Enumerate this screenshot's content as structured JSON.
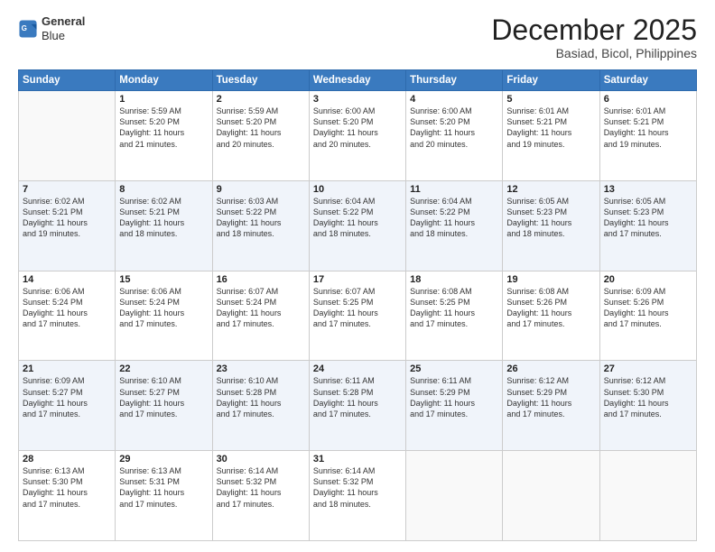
{
  "logo": {
    "line1": "General",
    "line2": "Blue"
  },
  "header": {
    "month": "December 2025",
    "location": "Basiad, Bicol, Philippines"
  },
  "weekdays": [
    "Sunday",
    "Monday",
    "Tuesday",
    "Wednesday",
    "Thursday",
    "Friday",
    "Saturday"
  ],
  "weeks": [
    [
      {
        "day": "",
        "sunrise": "",
        "sunset": "",
        "daylight": ""
      },
      {
        "day": "1",
        "sunrise": "Sunrise: 5:59 AM",
        "sunset": "Sunset: 5:20 PM",
        "daylight": "Daylight: 11 hours and 21 minutes."
      },
      {
        "day": "2",
        "sunrise": "Sunrise: 5:59 AM",
        "sunset": "Sunset: 5:20 PM",
        "daylight": "Daylight: 11 hours and 20 minutes."
      },
      {
        "day": "3",
        "sunrise": "Sunrise: 6:00 AM",
        "sunset": "Sunset: 5:20 PM",
        "daylight": "Daylight: 11 hours and 20 minutes."
      },
      {
        "day": "4",
        "sunrise": "Sunrise: 6:00 AM",
        "sunset": "Sunset: 5:20 PM",
        "daylight": "Daylight: 11 hours and 20 minutes."
      },
      {
        "day": "5",
        "sunrise": "Sunrise: 6:01 AM",
        "sunset": "Sunset: 5:21 PM",
        "daylight": "Daylight: 11 hours and 19 minutes."
      },
      {
        "day": "6",
        "sunrise": "Sunrise: 6:01 AM",
        "sunset": "Sunset: 5:21 PM",
        "daylight": "Daylight: 11 hours and 19 minutes."
      }
    ],
    [
      {
        "day": "7",
        "sunrise": "Sunrise: 6:02 AM",
        "sunset": "Sunset: 5:21 PM",
        "daylight": "Daylight: 11 hours and 19 minutes."
      },
      {
        "day": "8",
        "sunrise": "Sunrise: 6:02 AM",
        "sunset": "Sunset: 5:21 PM",
        "daylight": "Daylight: 11 hours and 18 minutes."
      },
      {
        "day": "9",
        "sunrise": "Sunrise: 6:03 AM",
        "sunset": "Sunset: 5:22 PM",
        "daylight": "Daylight: 11 hours and 18 minutes."
      },
      {
        "day": "10",
        "sunrise": "Sunrise: 6:04 AM",
        "sunset": "Sunset: 5:22 PM",
        "daylight": "Daylight: 11 hours and 18 minutes."
      },
      {
        "day": "11",
        "sunrise": "Sunrise: 6:04 AM",
        "sunset": "Sunset: 5:22 PM",
        "daylight": "Daylight: 11 hours and 18 minutes."
      },
      {
        "day": "12",
        "sunrise": "Sunrise: 6:05 AM",
        "sunset": "Sunset: 5:23 PM",
        "daylight": "Daylight: 11 hours and 18 minutes."
      },
      {
        "day": "13",
        "sunrise": "Sunrise: 6:05 AM",
        "sunset": "Sunset: 5:23 PM",
        "daylight": "Daylight: 11 hours and 17 minutes."
      }
    ],
    [
      {
        "day": "14",
        "sunrise": "Sunrise: 6:06 AM",
        "sunset": "Sunset: 5:24 PM",
        "daylight": "Daylight: 11 hours and 17 minutes."
      },
      {
        "day": "15",
        "sunrise": "Sunrise: 6:06 AM",
        "sunset": "Sunset: 5:24 PM",
        "daylight": "Daylight: 11 hours and 17 minutes."
      },
      {
        "day": "16",
        "sunrise": "Sunrise: 6:07 AM",
        "sunset": "Sunset: 5:24 PM",
        "daylight": "Daylight: 11 hours and 17 minutes."
      },
      {
        "day": "17",
        "sunrise": "Sunrise: 6:07 AM",
        "sunset": "Sunset: 5:25 PM",
        "daylight": "Daylight: 11 hours and 17 minutes."
      },
      {
        "day": "18",
        "sunrise": "Sunrise: 6:08 AM",
        "sunset": "Sunset: 5:25 PM",
        "daylight": "Daylight: 11 hours and 17 minutes."
      },
      {
        "day": "19",
        "sunrise": "Sunrise: 6:08 AM",
        "sunset": "Sunset: 5:26 PM",
        "daylight": "Daylight: 11 hours and 17 minutes."
      },
      {
        "day": "20",
        "sunrise": "Sunrise: 6:09 AM",
        "sunset": "Sunset: 5:26 PM",
        "daylight": "Daylight: 11 hours and 17 minutes."
      }
    ],
    [
      {
        "day": "21",
        "sunrise": "Sunrise: 6:09 AM",
        "sunset": "Sunset: 5:27 PM",
        "daylight": "Daylight: 11 hours and 17 minutes."
      },
      {
        "day": "22",
        "sunrise": "Sunrise: 6:10 AM",
        "sunset": "Sunset: 5:27 PM",
        "daylight": "Daylight: 11 hours and 17 minutes."
      },
      {
        "day": "23",
        "sunrise": "Sunrise: 6:10 AM",
        "sunset": "Sunset: 5:28 PM",
        "daylight": "Daylight: 11 hours and 17 minutes."
      },
      {
        "day": "24",
        "sunrise": "Sunrise: 6:11 AM",
        "sunset": "Sunset: 5:28 PM",
        "daylight": "Daylight: 11 hours and 17 minutes."
      },
      {
        "day": "25",
        "sunrise": "Sunrise: 6:11 AM",
        "sunset": "Sunset: 5:29 PM",
        "daylight": "Daylight: 11 hours and 17 minutes."
      },
      {
        "day": "26",
        "sunrise": "Sunrise: 6:12 AM",
        "sunset": "Sunset: 5:29 PM",
        "daylight": "Daylight: 11 hours and 17 minutes."
      },
      {
        "day": "27",
        "sunrise": "Sunrise: 6:12 AM",
        "sunset": "Sunset: 5:30 PM",
        "daylight": "Daylight: 11 hours and 17 minutes."
      }
    ],
    [
      {
        "day": "28",
        "sunrise": "Sunrise: 6:13 AM",
        "sunset": "Sunset: 5:30 PM",
        "daylight": "Daylight: 11 hours and 17 minutes."
      },
      {
        "day": "29",
        "sunrise": "Sunrise: 6:13 AM",
        "sunset": "Sunset: 5:31 PM",
        "daylight": "Daylight: 11 hours and 17 minutes."
      },
      {
        "day": "30",
        "sunrise": "Sunrise: 6:14 AM",
        "sunset": "Sunset: 5:32 PM",
        "daylight": "Daylight: 11 hours and 17 minutes."
      },
      {
        "day": "31",
        "sunrise": "Sunrise: 6:14 AM",
        "sunset": "Sunset: 5:32 PM",
        "daylight": "Daylight: 11 hours and 18 minutes."
      },
      {
        "day": "",
        "sunrise": "",
        "sunset": "",
        "daylight": ""
      },
      {
        "day": "",
        "sunrise": "",
        "sunset": "",
        "daylight": ""
      },
      {
        "day": "",
        "sunrise": "",
        "sunset": "",
        "daylight": ""
      }
    ]
  ]
}
